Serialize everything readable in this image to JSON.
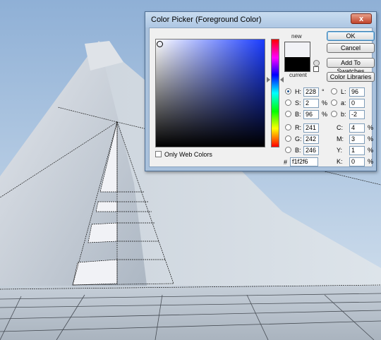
{
  "dialog": {
    "title": "Color Picker (Foreground Color)",
    "close_glyph": "x",
    "new_label": "new",
    "current_label": "current",
    "new_color": "#f1f2f6",
    "current_color": "#000000",
    "buttons": {
      "ok": "OK",
      "cancel": "Cancel",
      "add_to_swatches": "Add To Swatches",
      "color_libraries": "Color Libraries"
    },
    "hsb": {
      "h_label": "H:",
      "h_value": "228",
      "h_unit": "°",
      "s_label": "S:",
      "s_value": "2",
      "s_unit": "%",
      "b_label": "B:",
      "b_value": "96",
      "b_unit": "%"
    },
    "rgb": {
      "r_label": "R:",
      "r_value": "241",
      "g_label": "G:",
      "g_value": "242",
      "b_label": "B:",
      "b_value": "246"
    },
    "lab": {
      "l_label": "L:",
      "l_value": "96",
      "a_label": "a:",
      "a_value": "0",
      "b_label": "b:",
      "b_value": "-2"
    },
    "cmyk": {
      "c_label": "C:",
      "c_value": "4",
      "m_label": "M:",
      "m_value": "3",
      "y_label": "Y:",
      "y_value": "1",
      "k_label": "K:",
      "k_value": "0",
      "unit": "%"
    },
    "hex_label": "#",
    "hex_value": "f1f2f6",
    "web_colors_label": "Only Web Colors",
    "selected_mode": "H"
  },
  "icons": [
    "gamut-warning-icon",
    "web-safe-icon"
  ]
}
